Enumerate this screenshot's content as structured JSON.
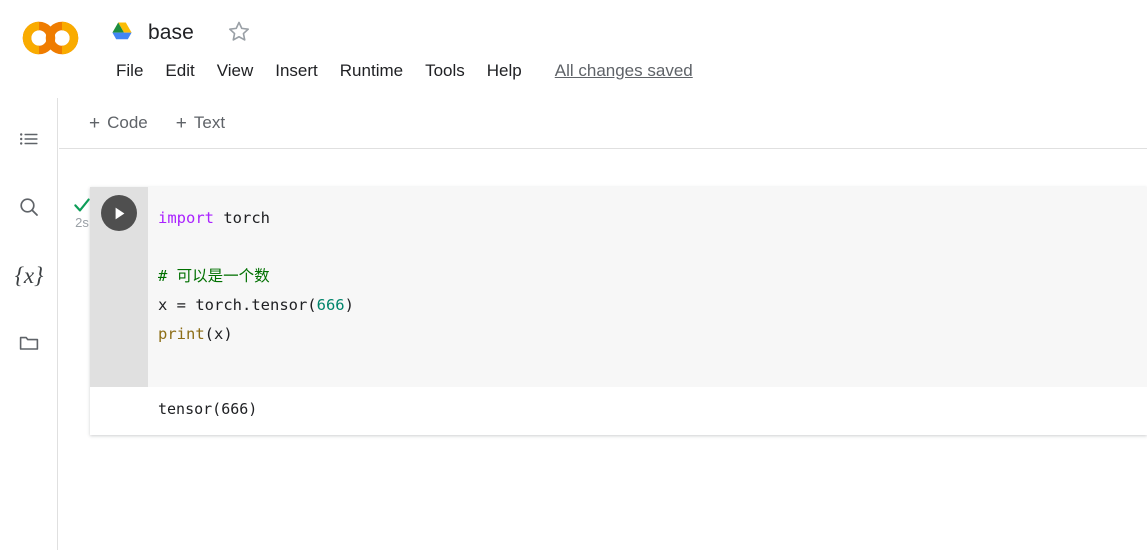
{
  "header": {
    "logo_icon": "colab-logo-icon",
    "drive_icon": "google-drive-icon",
    "doc_title": "base",
    "star_icon": "star-outline-icon",
    "menu_items": [
      {
        "label": "File"
      },
      {
        "label": "Edit"
      },
      {
        "label": "View"
      },
      {
        "label": "Insert"
      },
      {
        "label": "Runtime"
      },
      {
        "label": "Tools"
      },
      {
        "label": "Help"
      }
    ],
    "save_status": "All changes saved"
  },
  "left_rail": {
    "items": [
      {
        "name": "table-of-contents",
        "icon": "list-icon"
      },
      {
        "name": "search",
        "icon": "search-icon"
      },
      {
        "name": "variables",
        "icon": "variables-icon",
        "glyph": "{x}"
      },
      {
        "name": "files",
        "icon": "folder-icon"
      }
    ]
  },
  "toolbar": {
    "add_code_label": "Code",
    "add_text_label": "Text",
    "plus_glyph": "+"
  },
  "cell": {
    "status": {
      "check_icon": "green-check-icon",
      "exec_time": "2s"
    },
    "run_button": {
      "icon": "play-icon",
      "label": "Run cell"
    },
    "code_lines": [
      [
        {
          "t": "import",
          "c": "kw"
        },
        {
          "t": " torch",
          "c": "plain"
        }
      ],
      [],
      [
        {
          "t": "# 可以是一个数",
          "c": "comment"
        }
      ],
      [
        {
          "t": "x = torch.tensor(",
          "c": "plain"
        },
        {
          "t": "666",
          "c": "num"
        },
        {
          "t": ")",
          "c": "plain"
        }
      ],
      [
        {
          "t": "print",
          "c": "builtin"
        },
        {
          "t": "(x)",
          "c": "plain"
        }
      ]
    ],
    "output_text": "tensor(666)"
  },
  "colors": {
    "accent_orange": "#f9ab00",
    "keyword": "#aa22ff",
    "comment": "#007000",
    "number": "#00846b",
    "builtin": "#8d6e17",
    "gutter": "#e0e0e0",
    "code_bg": "#f7f7f7",
    "run_button": "#4f4f4f",
    "check_green": "#0d9d58"
  }
}
